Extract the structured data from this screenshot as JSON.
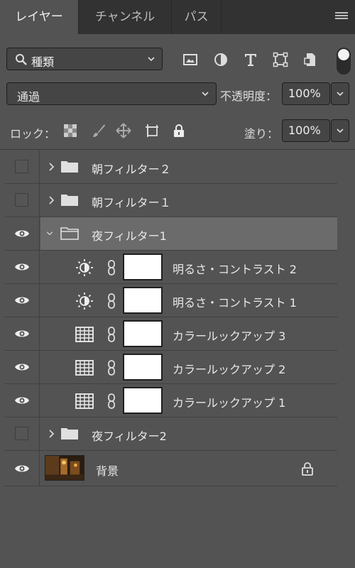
{
  "tabs": [
    {
      "label": "レイヤー",
      "active": true
    },
    {
      "label": "チャンネル",
      "active": false
    },
    {
      "label": "パス",
      "active": false
    }
  ],
  "filter": {
    "kind_label": "種類",
    "icons": [
      "image-filter-icon",
      "adjustment-filter-icon",
      "type-filter-icon",
      "shape-filter-icon",
      "smart-object-filter-icon"
    ]
  },
  "blend": {
    "mode": "通過",
    "opacity_label": "不透明度：",
    "opacity_value": "100%"
  },
  "lock": {
    "label": "ロック：",
    "fill_label": "塗り：",
    "fill_value": "100%"
  },
  "colors": {
    "panel": "#535353",
    "tabbar": "#323232",
    "selected": "#6b6b6b"
  },
  "layers": [
    {
      "name": "朝フィルター２",
      "type": "group",
      "visible": false,
      "expanded": false
    },
    {
      "name": "朝フィルター１",
      "type": "group",
      "visible": false,
      "expanded": false
    },
    {
      "name": "夜フィルター1",
      "type": "group",
      "visible": true,
      "expanded": true,
      "selected": true
    },
    {
      "name": "明るさ・コントラスト 2",
      "type": "adjustment",
      "icon": "brightness-contrast-icon",
      "visible": true
    },
    {
      "name": "明るさ・コントラスト 1",
      "type": "adjustment",
      "icon": "brightness-contrast-icon",
      "visible": true
    },
    {
      "name": "カラールックアップ 3",
      "type": "adjustment",
      "icon": "color-lookup-icon",
      "visible": true
    },
    {
      "name": "カラールックアップ 2",
      "type": "adjustment",
      "icon": "color-lookup-icon",
      "visible": true
    },
    {
      "name": "カラールックアップ 1",
      "type": "adjustment",
      "icon": "color-lookup-icon",
      "visible": true
    },
    {
      "name": "夜フィルター2",
      "type": "group",
      "visible": false,
      "expanded": false
    },
    {
      "name": "背景",
      "type": "background",
      "visible": true,
      "locked": true
    }
  ]
}
